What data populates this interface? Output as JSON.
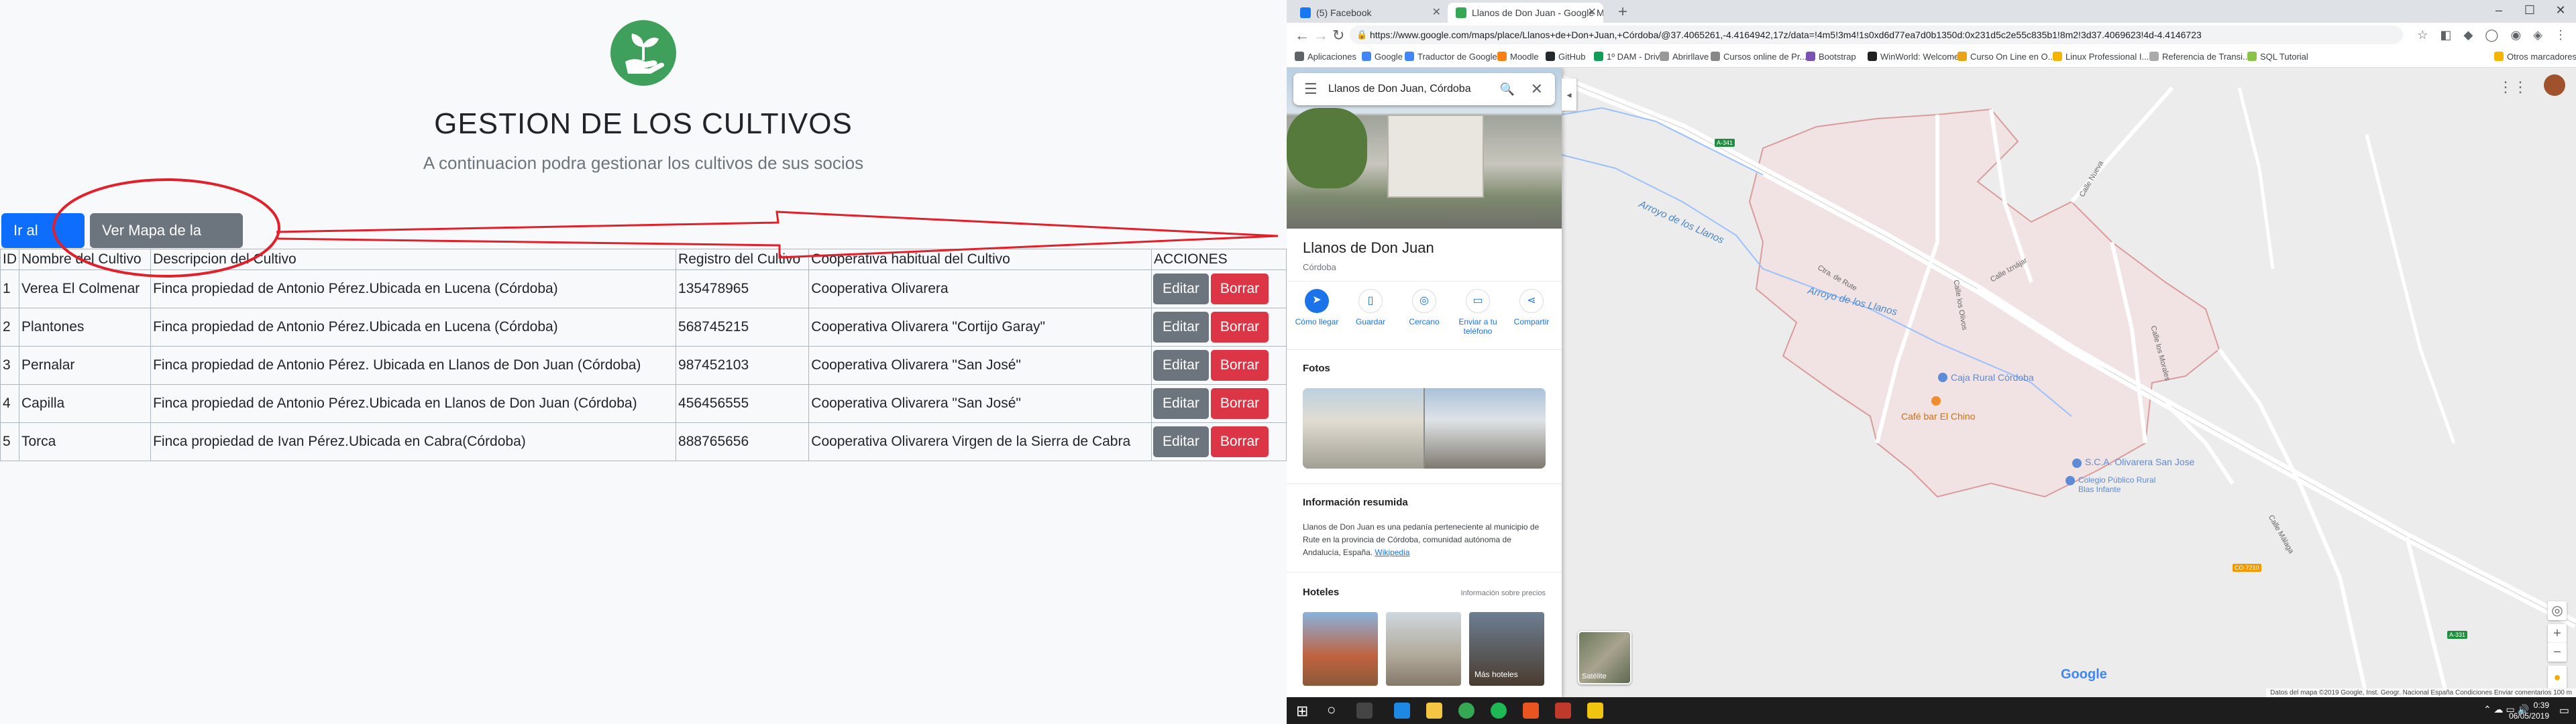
{
  "left": {
    "title": "GESTION DE LOS CULTIVOS",
    "subtitle": "A continuacion podra gestionar los cultivos de sus socios",
    "buttons": {
      "menu": "Ir al menu",
      "map": "Ver Mapa de la zona"
    },
    "table": {
      "headers": [
        "ID",
        "Nombre del Cultivo",
        "Descripcion del Cultivo",
        "Registro del Cultivo",
        "Cooperativa habitual del Cultivo",
        "ACCIONES"
      ],
      "rows": [
        [
          "1",
          "Verea El Colmenar",
          "Finca propiedad de Antonio Pérez.Ubicada en Lucena (Córdoba)",
          "135478965",
          "Cooperativa Olivarera"
        ],
        [
          "2",
          "Plantones",
          "Finca propiedad de Antonio Pérez.Ubicada en Lucena (Córdoba)",
          "568745215",
          "Cooperativa Olivarera \"Cortijo Garay\""
        ],
        [
          "3",
          "Pernalar",
          "Finca propiedad de Antonio Pérez. Ubicada en Llanos de Don Juan (Córdoba)",
          "987452103",
          "Cooperativa Olivarera \"San José\""
        ],
        [
          "4",
          "Capilla",
          "Finca propiedad de Antonio Pérez.Ubicada en Llanos de Don Juan (Córdoba)",
          "456456555",
          "Cooperativa Olivarera \"San José\""
        ],
        [
          "5",
          "Torca",
          "Finca propiedad de Ivan Pérez.Ubicada en Cabra(Córdoba)",
          "888765656",
          "Cooperativa Olivarera Virgen de la Sierra de Cabra"
        ]
      ],
      "edit_label": "Editar",
      "delete_label": "Borrar"
    },
    "colors": {
      "primary": "#0d6efd",
      "secondary": "#6c757d",
      "danger": "#dc3545",
      "logo": "#3ea05a",
      "annotation": "#e0202a"
    }
  },
  "browser": {
    "tabs": [
      {
        "title": "(5) Facebook",
        "icon": "facebook-icon"
      },
      {
        "title": "Llanos de Don Juan - Google Ma...",
        "icon": "google-maps-icon"
      }
    ],
    "url": "https://www.google.com/maps/place/Llanos+de+Don+Juan,+Córdoba/@37.4065261,-4.4164942,17z/data=!4m5!3m4!1s0xd6d77ea7d0b1350d:0x231d5c2e55c835b1!8m2!3d37.4069623!4d-4.4146723",
    "bookmarks": [
      "Aplicaciones",
      "Google",
      "Traductor de Google",
      "Moodle",
      "GitHub",
      "1º DAM - Drive",
      "Abrirllave",
      "Cursos online de Pr...",
      "Bootstrap",
      "WinWorld: Welcome",
      "Curso On Line en O...",
      "Linux Professional I...",
      "Referencia de Transi...",
      "SQL Tutorial",
      "Otros marcadores"
    ]
  },
  "maps": {
    "search_value": "Llanos de Don Juan, Córdoba",
    "place_title": "Llanos de Don Juan",
    "place_subtitle": "Córdoba",
    "actions": [
      "Cómo llegar",
      "Guardar",
      "Cercano",
      "Enviar a tu teléfono",
      "Compartir"
    ],
    "photos_heading": "Fotos",
    "summary_heading": "Información resumida",
    "summary_text": "Llanos de Don Juan es una pedanía perteneciente al municipio de Rute en la provincia de Córdoba, comunidad autónoma de Andalucía, España.",
    "summary_link": "Wikipedia",
    "hotels_heading": "Hoteles",
    "hotels_info": "Información sobre precios",
    "more_hotels": "Más hoteles",
    "map_labels": {
      "pois": [
        "Caja Rural Córdoba",
        "Café bar El Chino",
        "S.C.A. Olivarera San Jose",
        "Colegio Público Rural Blas Infante"
      ],
      "water": [
        "Arroyo de los Llanos",
        "Arroyo de los Llanos"
      ],
      "streets": [
        "Ctra. de Rute",
        "Calle los Olivos",
        "Calle Iznájar",
        "Calle Nueva",
        "Calle los Morales",
        "Calle Málaga"
      ],
      "roads": [
        "A-341",
        "CO-7210",
        "A-331"
      ]
    },
    "satellite_label": "Satélite",
    "google_logo": "Google",
    "attribution": "Datos del mapa ©2019 Google, Inst. Geogr. Nacional   España   Condiciones   Enviar comentarios   100 m"
  },
  "taskbar": {
    "time": "0:39",
    "date": "06/05/2019"
  }
}
